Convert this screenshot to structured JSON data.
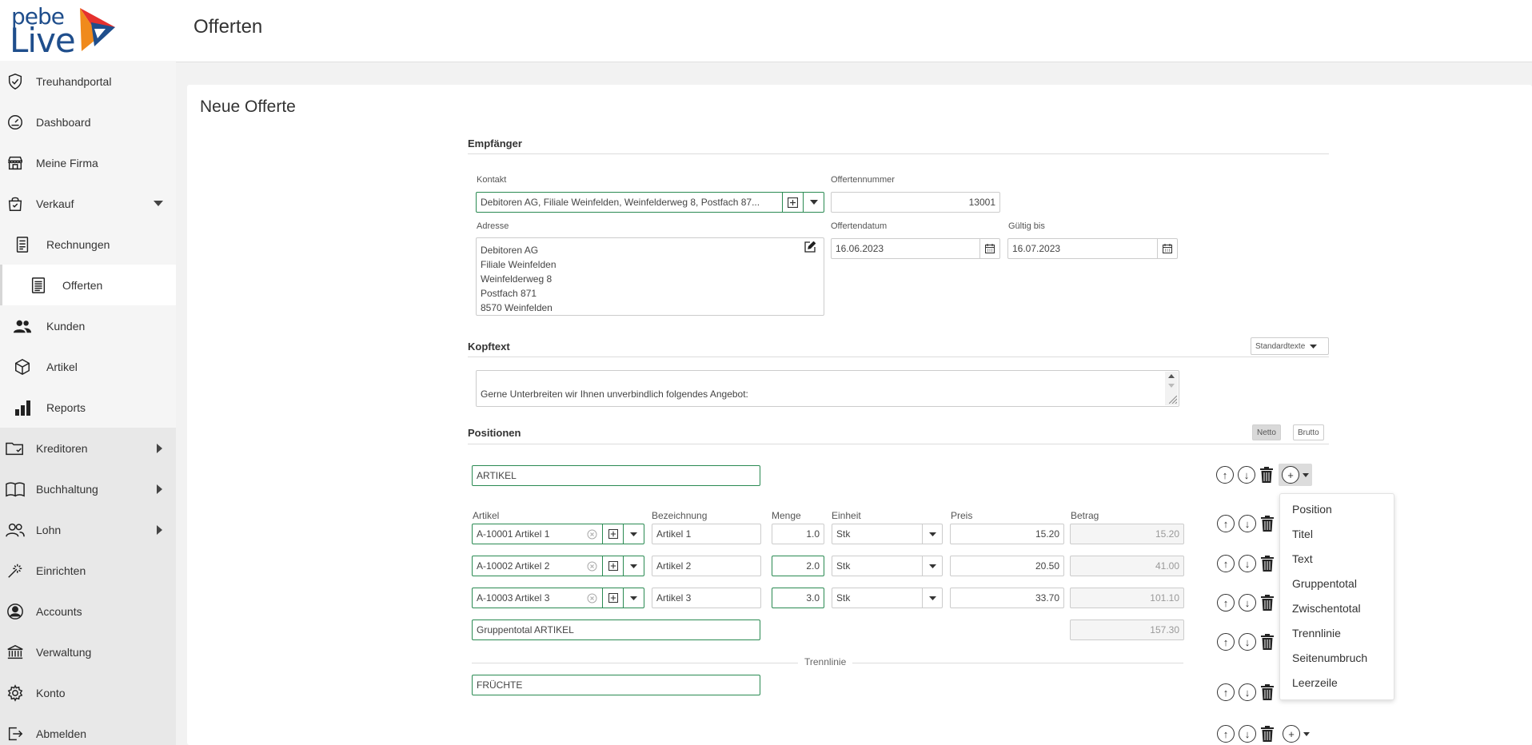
{
  "app": {
    "logo_top": "pebe",
    "logo_bottom": "Live",
    "page_title": "Offerten",
    "brand_colors": {
      "blue": "#1f4e8c",
      "red": "#e5312e",
      "orange": "#f08a1c",
      "green": "#2a8a52"
    }
  },
  "sidebar": {
    "items": [
      {
        "label": "Treuhandportal",
        "icon": "shield-check-icon"
      },
      {
        "label": "Dashboard",
        "icon": "speedometer-icon"
      },
      {
        "label": "Meine Firma",
        "icon": "store-icon"
      },
      {
        "label": "Verkauf",
        "icon": "shopping-bag-icon"
      },
      {
        "label": "Rechnungen",
        "icon": "document-icon"
      },
      {
        "label": "Offerten",
        "icon": "list-document-icon"
      },
      {
        "label": "Kunden",
        "icon": "people-icon"
      },
      {
        "label": "Artikel",
        "icon": "box-icon"
      },
      {
        "label": "Reports",
        "icon": "bar-chart-icon"
      },
      {
        "label": "Kreditoren",
        "icon": "folder-icon"
      },
      {
        "label": "Buchhaltung",
        "icon": "book-icon"
      },
      {
        "label": "Lohn",
        "icon": "users-icon"
      },
      {
        "label": "Einrichten",
        "icon": "magic-wand-icon"
      },
      {
        "label": "Accounts",
        "icon": "user-circle-icon"
      },
      {
        "label": "Verwaltung",
        "icon": "bank-icon"
      },
      {
        "label": "Konto",
        "icon": "gear-icon"
      },
      {
        "label": "Abmelden",
        "icon": "logout-icon"
      }
    ]
  },
  "form": {
    "title": "Neue Offerte",
    "empfaenger": {
      "section": "Empfänger",
      "kontakt_label": "Kontakt",
      "kontakt_value": "Debitoren AG, Filiale Weinfelden, Weinfelderweg 8, Postfach 87...",
      "offertennummer_label": "Offertennummer",
      "offertennummer_value": "13001",
      "adresse_label": "Adresse",
      "adresse_lines": [
        "Debitoren AG",
        "Filiale Weinfelden",
        "Weinfelderweg 8",
        "Postfach 871",
        "8570 Weinfelden"
      ],
      "offertendatum_label": "Offertendatum",
      "offertendatum_value": "16.06.2023",
      "gueltig_label": "Gültig bis",
      "gueltig_value": "16.07.2023"
    },
    "kopftext": {
      "section": "Kopftext",
      "standardtexte": "Standardtexte",
      "text": "Gerne Unterbreiten wir Ihnen unverbindlich folgendes Angebot:"
    },
    "positionen": {
      "section": "Positionen",
      "netto": "Netto",
      "brutto": "Brutto",
      "title_1": "ARTIKEL",
      "columns": {
        "artikel": "Artikel",
        "bezeichnung": "Bezeichnung",
        "menge": "Menge",
        "einheit": "Einheit",
        "preis": "Preis",
        "betrag": "Betrag"
      },
      "rows": [
        {
          "artikel": "A-10001 Artikel 1",
          "bezeichnung": "Artikel 1",
          "menge": "1.0",
          "einheit": "Stk",
          "preis": "15.20",
          "betrag": "15.20"
        },
        {
          "artikel": "A-10002 Artikel 2",
          "bezeichnung": "Artikel 2",
          "menge": "2.0",
          "einheit": "Stk",
          "preis": "20.50",
          "betrag": "41.00"
        },
        {
          "artikel": "A-10003 Artikel 3",
          "bezeichnung": "Artikel 3",
          "menge": "3.0",
          "einheit": "Stk",
          "preis": "33.70",
          "betrag": "101.10"
        }
      ],
      "gruppentotal_label": "Gruppentotal ARTIKEL",
      "gruppentotal_value": "157.30",
      "trennlinie": "Trennlinie",
      "title_2": "FRÜCHTE"
    }
  },
  "add_menu": {
    "options": [
      "Position",
      "Titel",
      "Text",
      "Gruppentotal",
      "Zwischentotal",
      "Trennlinie",
      "Seitenumbruch",
      "Leerzeile"
    ]
  }
}
